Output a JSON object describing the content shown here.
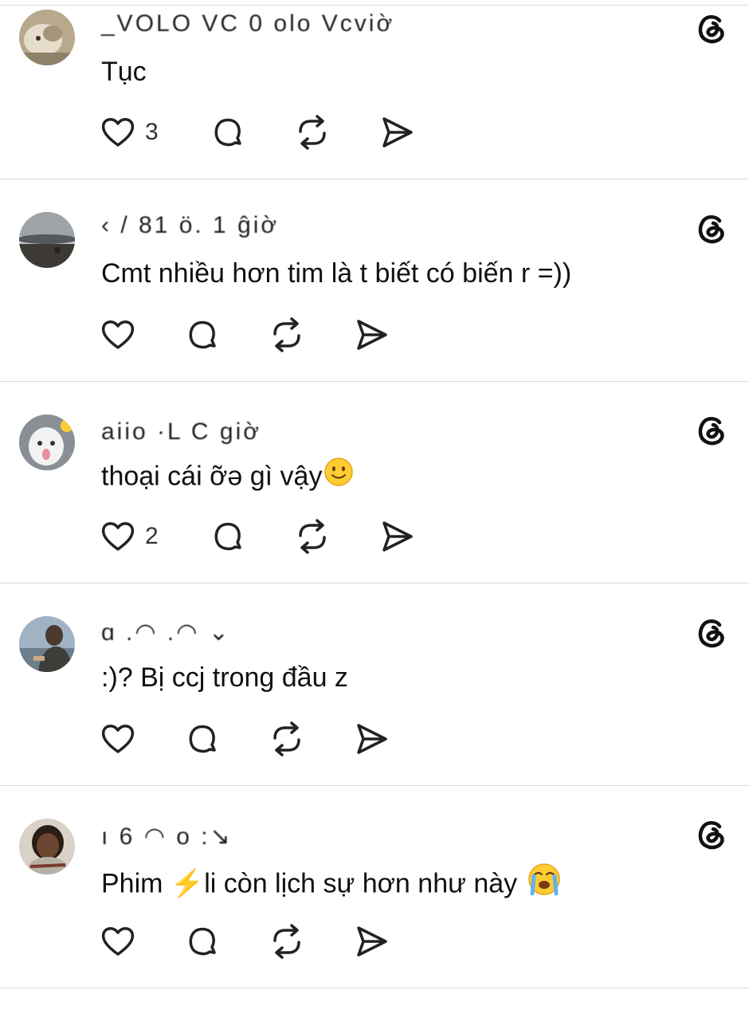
{
  "posts": [
    {
      "username": "_VOLO VC 0 olo Vcviờ",
      "text": "Tục",
      "like_count": "3",
      "emoji": "",
      "icons": {
        "like": "heart-icon",
        "reply": "comment-icon",
        "repost": "repost-icon",
        "share": "share-icon",
        "logo": "threads-logo-icon"
      }
    },
    {
      "username": "‹ / 81 ö. 1 ĝiờ",
      "text": "Cmt nhiều hơn tim là t biết có biến r =))",
      "like_count": "",
      "emoji": "",
      "icons": {
        "like": "heart-icon",
        "reply": "comment-icon",
        "repost": "repost-icon",
        "share": "share-icon",
        "logo": "threads-logo-icon"
      }
    },
    {
      "username": "aiio ·L  C  giờ",
      "text": "thoại cái ỡə gì vậy",
      "like_count": "2",
      "emoji": "slightly-smiling-face",
      "icons": {
        "like": "heart-icon",
        "reply": "comment-icon",
        "repost": "repost-icon",
        "share": "share-icon",
        "logo": "threads-logo-icon"
      }
    },
    {
      "username": "ɑ .◠  .◠  ⌄",
      "text": ":)? Bị ccj trong đầu z",
      "like_count": "",
      "emoji": "",
      "icons": {
        "like": "heart-icon",
        "reply": "comment-icon",
        "repost": "repost-icon",
        "share": "share-icon",
        "logo": "threads-logo-icon"
      }
    },
    {
      "username": "ı 6 ◠ o :↘",
      "text": "Phim ⚡li còn lịch sự hơn như này",
      "like_count": "",
      "emoji": "loudly-crying-face",
      "icons": {
        "like": "heart-icon",
        "reply": "comment-icon",
        "repost": "repost-icon",
        "share": "share-icon",
        "logo": "threads-logo-icon"
      }
    }
  ],
  "colors": {
    "text": "#111111",
    "divider": "#d9d9d9",
    "icon": "#222222",
    "emoji_yellow": "#ffcc33"
  }
}
